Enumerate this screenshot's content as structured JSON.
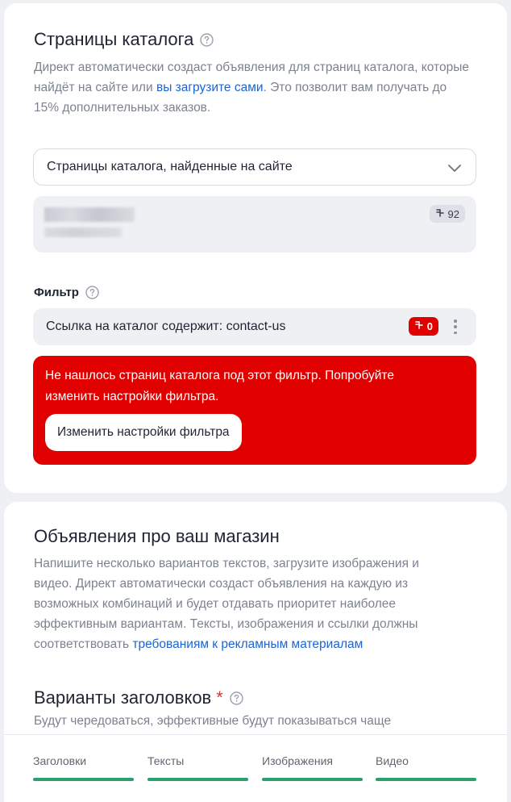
{
  "catalog_card": {
    "title": "Страницы каталога",
    "description_before": "Директ автоматически создаст объявления для страниц каталога, которые найдёт на сайте или ",
    "description_link": "вы загрузите сами",
    "description_after": ". Это позволит вам получать до 15% дополнительных заказов.",
    "source_select": {
      "value": "Страницы каталога, найденные на сайте"
    },
    "site": {
      "pages_count": "92"
    },
    "filter": {
      "label": "Фильтр",
      "condition": "Ссылка на каталог содержит: contact-us",
      "match_count": "0"
    },
    "error": {
      "message": "Не нашлось страниц каталога под этот фильтр. Попробуйте изменить настройки фильтра.",
      "button_label": "Изменить настройки фильтра"
    }
  },
  "ads_card": {
    "title": "Объявления про ваш магазин",
    "description_before": "Напишите несколько вариантов текстов, загрузите изображения и видео. Директ автоматически создаст объявления на каждую из возможных комбинаций и будет отдавать приоритет наиболее эффективным вариантам. Тексты, изображения и ссылки должны соответствовать ",
    "description_link": "требованиям к рекламным материалам",
    "headlines_title": "Варианты заголовков",
    "required_mark": "*",
    "headlines_description": "Будут чередоваться, эффективные будут показываться чаще"
  },
  "progress": {
    "items": [
      {
        "label": "Заголовки",
        "complete": true
      },
      {
        "label": "Тексты",
        "complete": true
      },
      {
        "label": "Изображения",
        "complete": true
      },
      {
        "label": "Видео",
        "complete": true
      }
    ],
    "accent_color": "#2aa06a"
  },
  "colors": {
    "error": "#e00000",
    "link": "#1a64d6"
  }
}
